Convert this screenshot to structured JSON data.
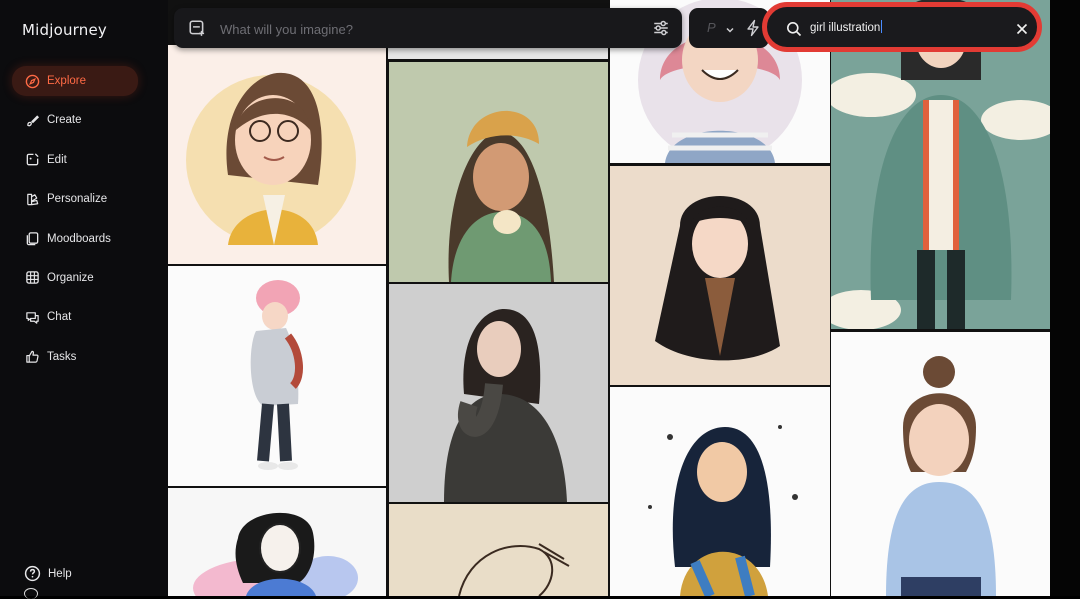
{
  "app": {
    "title": "Midjourney"
  },
  "sidebar": {
    "items": [
      {
        "label": "Explore",
        "icon": "compass-icon",
        "active": true
      },
      {
        "label": "Create",
        "icon": "brush-icon",
        "active": false
      },
      {
        "label": "Edit",
        "icon": "edit-image-icon",
        "active": false
      },
      {
        "label": "Personalize",
        "icon": "palette-icon",
        "active": false
      },
      {
        "label": "Moodboards",
        "icon": "moodboard-icon",
        "active": false
      },
      {
        "label": "Organize",
        "icon": "grid-icon",
        "active": false
      },
      {
        "label": "Chat",
        "icon": "chat-icon",
        "active": false
      },
      {
        "label": "Tasks",
        "icon": "thumbs-up-icon",
        "active": false
      }
    ],
    "help_label": "Help"
  },
  "prompt": {
    "placeholder": "What will you imagine?",
    "value": ""
  },
  "mode": {
    "label": "P"
  },
  "search": {
    "value": "girl illustration"
  },
  "colors": {
    "accent": "#ff6a45",
    "highlight_ring": "#e23b34",
    "sidebar_bg": "#0c0c0e"
  },
  "gallery": {
    "tiles": [
      {
        "subject": "girl with glasses and bob haircut, yellow cardigan"
      },
      {
        "subject": "girl in yellow beanie holding bread, green sweater"
      },
      {
        "subject": "smiling girl in striped shirt"
      },
      {
        "subject": "girl in green jacket with red trim, clouds background"
      },
      {
        "subject": "girl with pink hair in grey hoodie"
      },
      {
        "subject": "girl sitting in black sweater, photo style"
      },
      {
        "subject": "girl with long black hair on beige background"
      },
      {
        "subject": "girl with messy bun in blue sweater"
      },
      {
        "subject": "girl with dark hair, sketch style"
      },
      {
        "subject": "line sketch drawing"
      },
      {
        "subject": "watercolor girl with splatter"
      }
    ]
  }
}
